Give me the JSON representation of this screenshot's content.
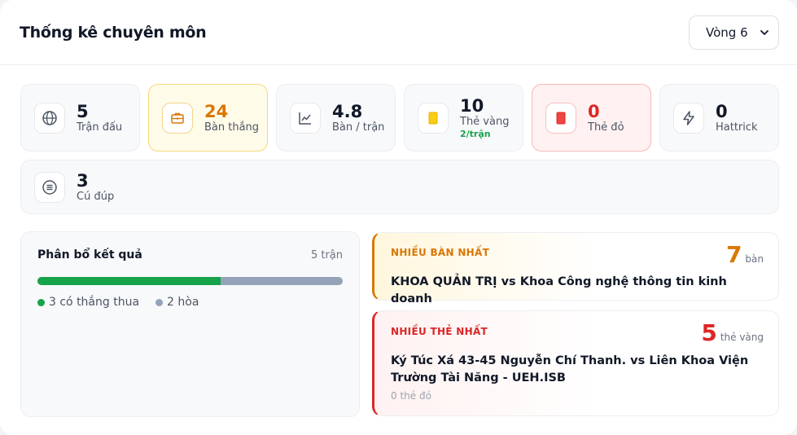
{
  "header": {
    "title": "Thống kê chuyên môn",
    "round_select": "Vòng 6"
  },
  "stats": {
    "matches": {
      "value": "5",
      "label": "Trận đấu",
      "icon": "globe-icon"
    },
    "goals": {
      "value": "24",
      "label": "Bàn thắng",
      "icon": "briefcase-icon"
    },
    "goals_per_match": {
      "value": "4.8",
      "label": "Bàn / trận",
      "icon": "chart-line-icon"
    },
    "yellow_cards": {
      "value": "10",
      "label": "Thẻ vàng",
      "sub": "2/trận",
      "icon": "yellow-card-icon"
    },
    "red_cards": {
      "value": "0",
      "label": "Thẻ đỏ",
      "icon": "red-card-icon"
    },
    "hattrick": {
      "value": "0",
      "label": "Hattrick",
      "icon": "lightning-icon"
    },
    "brace": {
      "value": "3",
      "label": "Cú đúp",
      "icon": "list-circle-icon"
    }
  },
  "distribution": {
    "title": "Phân bổ kết quả",
    "count": "5 trận",
    "decisive_fraction": 0.6,
    "legend_decisive": "3 có thắng thua",
    "legend_draw": "2 hòa",
    "colors": {
      "decisive": "#16a34a",
      "draw": "#94a3b8"
    }
  },
  "most_goals": {
    "label": "NHIỀU BÀN NHẤT",
    "number": "7",
    "unit": "bàn",
    "match": "KHOA QUẢN TRỊ vs Khoa Công nghệ thông tin kinh doanh"
  },
  "most_cards": {
    "label": "NHIỀU THẺ NHẤT",
    "number": "5",
    "unit": "thẻ vàng",
    "match": "Ký Túc Xá 43-45 Nguyễn Chí Thanh. vs Liên Khoa Viện Trường Tài Năng - UEH.ISB",
    "sub": "0 thẻ đỏ"
  },
  "colors": {
    "accent_gold": "#d97706",
    "accent_red": "#dc2626",
    "accent_green": "#16a34a"
  }
}
